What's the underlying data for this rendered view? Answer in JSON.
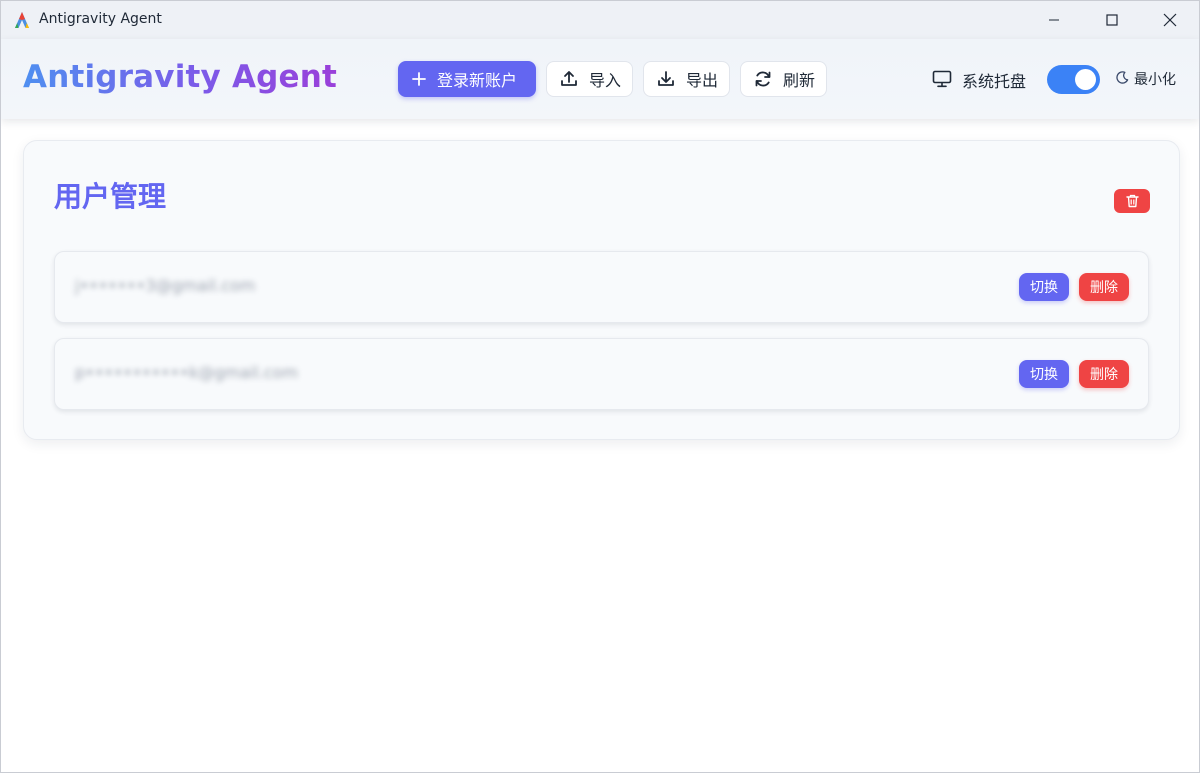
{
  "window": {
    "title": "Antigravity Agent",
    "icons": {
      "app": "antigravity-logo",
      "minimize": "minimize-icon",
      "maximize": "maximize-icon",
      "close": "close-icon"
    }
  },
  "header": {
    "brand": "Antigravity Agent",
    "buttons": {
      "login": {
        "label": "登录新账户",
        "icon": "plus-icon"
      },
      "import": {
        "label": "导入",
        "icon": "upload-icon"
      },
      "export": {
        "label": "导出",
        "icon": "download-icon"
      },
      "refresh": {
        "label": "刷新",
        "icon": "refresh-icon"
      }
    },
    "tray": {
      "label": "系统托盘",
      "icon": "monitor-icon",
      "enabled": true
    },
    "minimize": {
      "label": "最小化",
      "icon": "moon-icon"
    }
  },
  "main": {
    "title": "用户管理",
    "clear_icon": "trash-icon",
    "accounts": [
      {
        "email": "j•••••••3@gmail.com",
        "switch_label": "切换",
        "delete_label": "删除"
      },
      {
        "email": "p•••••••••••k@gmail.com",
        "switch_label": "切换",
        "delete_label": "删除"
      }
    ]
  },
  "colors": {
    "primary": "#6366f1",
    "danger": "#ef4444",
    "toggle_on": "#3b82f6",
    "brand_gradient_start": "#4f8ff0",
    "brand_gradient_end": "#9a3fd9"
  }
}
